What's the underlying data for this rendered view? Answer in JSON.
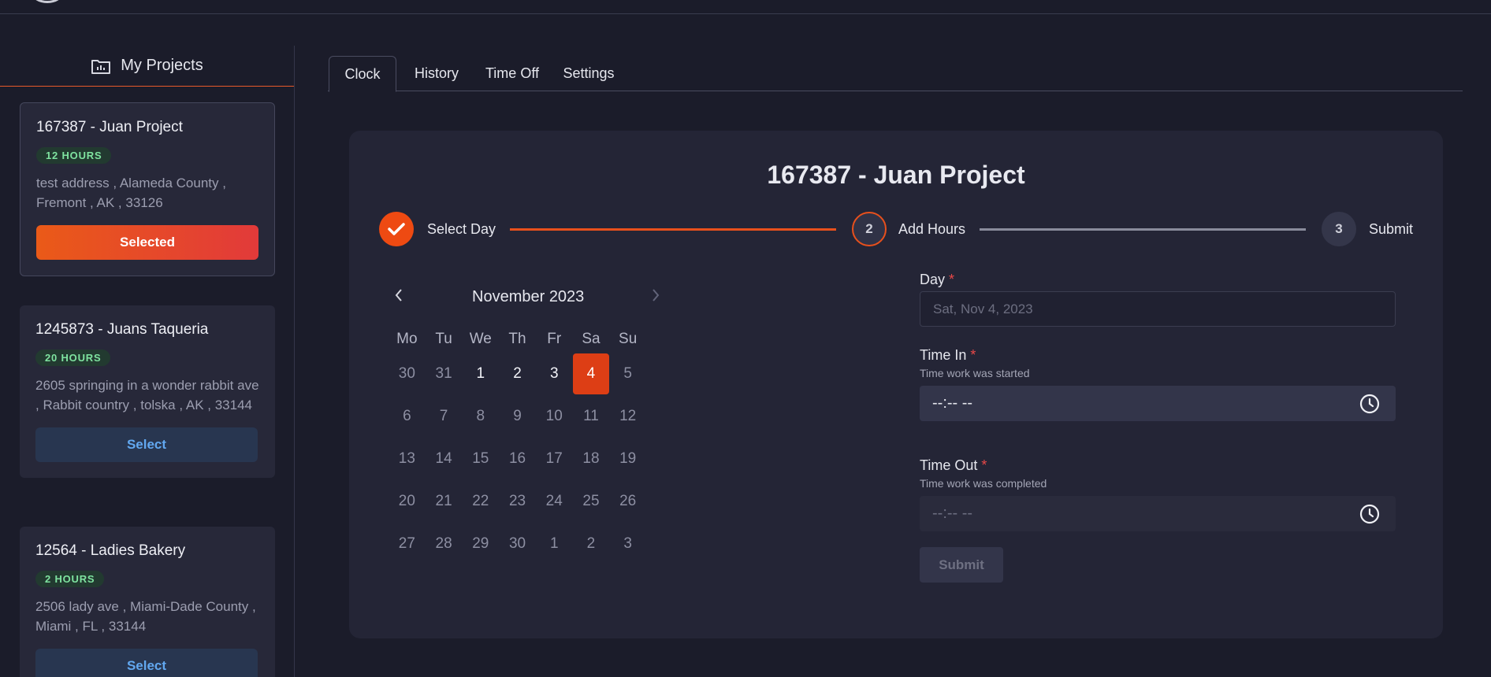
{
  "sidebar": {
    "title": "My Projects",
    "projects": [
      {
        "name": "167387 - Juan Project",
        "hours": "12 HOURS",
        "address": "test address , Alameda County , Fremont , AK , 33126",
        "button": "Selected"
      },
      {
        "name": "1245873 - Juans Taqueria",
        "hours": "20 HOURS",
        "address": "2605 springing in a wonder rabbit ave , Rabbit country , tolska , AK , 33144",
        "button": "Select"
      },
      {
        "name": "12564 - Ladies Bakery",
        "hours": "2 HOURS",
        "address": "2506 lady ave , Miami-Dade County , Miami , FL , 33144",
        "button": "Select"
      }
    ]
  },
  "tabs": [
    "Clock",
    "History",
    "Time Off",
    "Settings"
  ],
  "main": {
    "title": "167387 - Juan Project",
    "steps": [
      {
        "number": "1",
        "label": "Select Day",
        "state": "done"
      },
      {
        "number": "2",
        "label": "Add Hours",
        "state": "active"
      },
      {
        "number": "3",
        "label": "Submit",
        "state": "pending"
      }
    ],
    "calendar": {
      "month": "November 2023",
      "prev": "‹",
      "next": "›",
      "weekdays": [
        "Mo",
        "Tu",
        "We",
        "Th",
        "Fr",
        "Sa",
        "Su"
      ],
      "selected": "4",
      "weeks": [
        [
          [
            "30",
            "out"
          ],
          [
            "31",
            "out"
          ],
          [
            "1",
            "cur"
          ],
          [
            "2",
            "cur"
          ],
          [
            "3",
            "cur"
          ],
          [
            "4",
            "sel"
          ],
          [
            "5",
            "out"
          ]
        ],
        [
          [
            "6",
            "out"
          ],
          [
            "7",
            "out"
          ],
          [
            "8",
            "out"
          ],
          [
            "9",
            "out"
          ],
          [
            "10",
            "out"
          ],
          [
            "11",
            "out"
          ],
          [
            "12",
            "out"
          ]
        ],
        [
          [
            "13",
            "out"
          ],
          [
            "14",
            "out"
          ],
          [
            "15",
            "out"
          ],
          [
            "16",
            "out"
          ],
          [
            "17",
            "out"
          ],
          [
            "18",
            "out"
          ],
          [
            "19",
            "out"
          ]
        ],
        [
          [
            "20",
            "out"
          ],
          [
            "21",
            "out"
          ],
          [
            "22",
            "out"
          ],
          [
            "23",
            "out"
          ],
          [
            "24",
            "out"
          ],
          [
            "25",
            "out"
          ],
          [
            "26",
            "out"
          ]
        ],
        [
          [
            "27",
            "out"
          ],
          [
            "28",
            "out"
          ],
          [
            "29",
            "out"
          ],
          [
            "30",
            "out"
          ],
          [
            "1",
            "out"
          ],
          [
            "2",
            "out"
          ],
          [
            "3",
            "out"
          ]
        ]
      ]
    },
    "form": {
      "day_label": "Day",
      "day_placeholder": "Sat, Nov 4, 2023",
      "time_in_label": "Time In",
      "time_in_help": "Time work was started",
      "time_in_value": "--:-- --",
      "time_out_label": "Time Out",
      "time_out_help": "Time work was completed",
      "time_out_value": "--:-- --",
      "required_mark": "*",
      "submit": "Submit"
    }
  },
  "colors": {
    "accent": "#e8501c",
    "background": "#1b1c2a",
    "panel": "#242536",
    "badge_text": "#7fe3a0",
    "select_text": "#62a8f0"
  },
  "icons": [
    "folder-chart-icon",
    "check-icon",
    "chevron-left-icon",
    "chevron-right-icon",
    "clock-icon"
  ]
}
